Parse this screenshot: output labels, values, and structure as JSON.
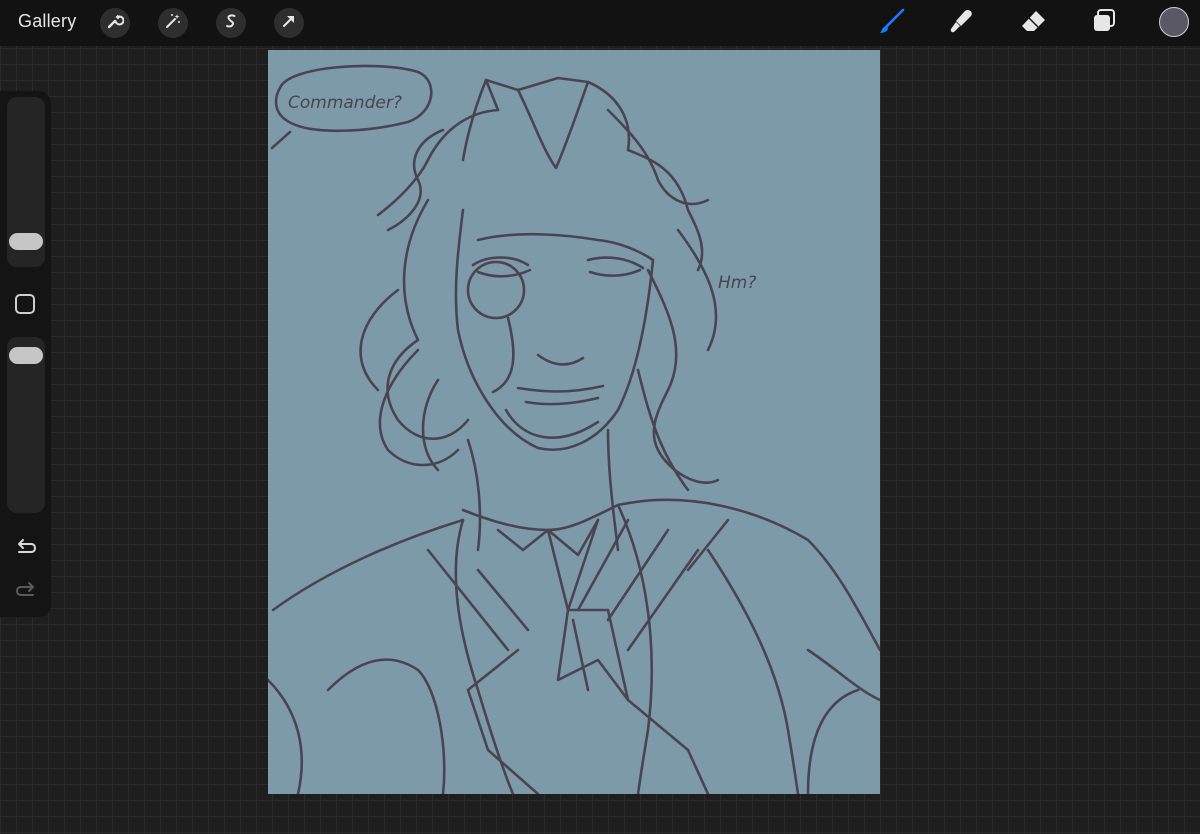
{
  "topbar": {
    "gallery_label": "Gallery",
    "left_tools": [
      "wrench-icon",
      "magic-wand-icon",
      "selection-s-icon",
      "transform-arrow-icon"
    ],
    "right_tools": [
      "brush-icon",
      "smudge-icon",
      "eraser-icon",
      "layers-icon"
    ],
    "active_tool": "brush-icon",
    "active_tool_color": "#1a7bff",
    "current_color": "#5b5866"
  },
  "sidebar": {
    "actions": [
      "undo-icon",
      "redo-icon"
    ]
  },
  "canvas": {
    "background_color": "#7d9aa9",
    "stroke_color": "#4a4452",
    "speech_bubble_text": "Commander?",
    "side_note_text": "Hm?"
  }
}
